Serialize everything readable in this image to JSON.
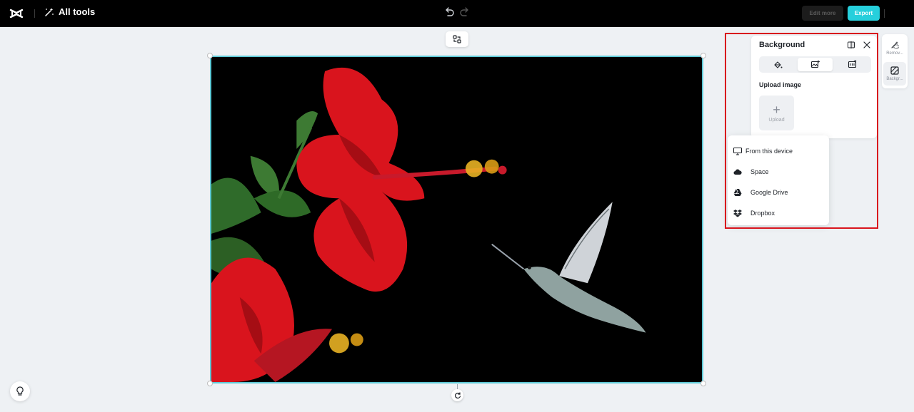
{
  "topbar": {
    "all_tools_label": "All tools",
    "edit_more_label": "Edit more",
    "export_label": "Export",
    "accent": "#26cfdc"
  },
  "background_panel": {
    "title": "Background",
    "tabs": [
      {
        "icon": "paint-bucket-icon",
        "active": false
      },
      {
        "icon": "image-add-icon",
        "active": true
      },
      {
        "icon": "template-icon",
        "active": false
      }
    ],
    "upload_label": "Upload image",
    "upload_button_label": "Upload"
  },
  "upload_menu": {
    "items": [
      {
        "label": "From this device",
        "icon": "monitor-icon"
      },
      {
        "label": "Space",
        "icon": "cloud-icon"
      },
      {
        "label": "Google Drive",
        "icon": "google-drive-icon"
      },
      {
        "label": "Dropbox",
        "icon": "dropbox-icon"
      }
    ]
  },
  "right_rail": {
    "items": [
      {
        "label": "Remov...",
        "icon": "remove-background-icon",
        "active": false
      },
      {
        "label": "Backgr...",
        "icon": "background-icon",
        "active": true
      }
    ]
  },
  "canvas": {
    "image_description_icon": "hibiscus-hummingbird-image",
    "frame_color": "#5fc9d6"
  },
  "highlight_color": "#d9141d"
}
